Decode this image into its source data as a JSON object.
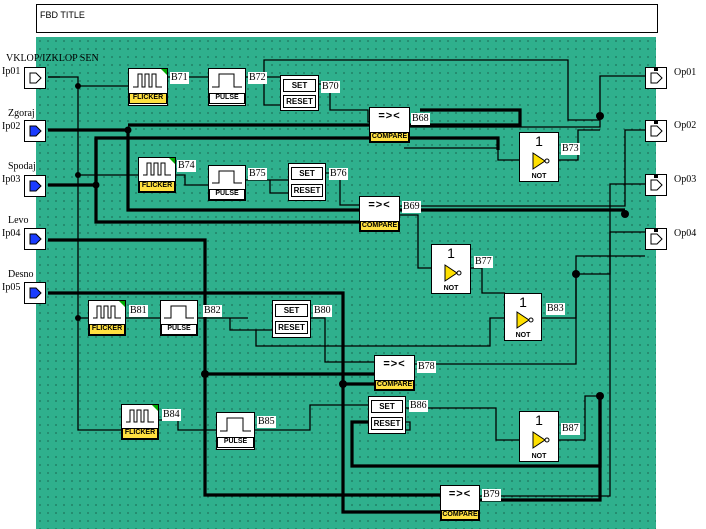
{
  "title": "FBD TITLE",
  "inputs": [
    {
      "id": "Ip01",
      "name": "VKLOP/IZKLOP SEN",
      "color": "#ffffff"
    },
    {
      "id": "Ip02",
      "name": "Zgoraj",
      "color": "#1a3cff"
    },
    {
      "id": "Ip03",
      "name": "Spodaj",
      "color": "#ffffff"
    },
    {
      "id": "Ip04",
      "name": "Levo",
      "color": "#1a3cff"
    },
    {
      "id": "Ip05",
      "name": "Desno",
      "color": "#1a3cff"
    }
  ],
  "outputs": [
    {
      "id": "Op01"
    },
    {
      "id": "Op02"
    },
    {
      "id": "Op03"
    },
    {
      "id": "Op04"
    }
  ],
  "blocks": {
    "b71": {
      "label": "B71",
      "type": "FLICKER",
      "icon": "flicker-icon"
    },
    "b72": {
      "label": "B72",
      "type": "PULSE",
      "icon": "pulse-icon"
    },
    "b70": {
      "label": "B70",
      "type_set": "SET",
      "type_reset": "RESET"
    },
    "b68": {
      "label": "B68",
      "symbol": "=><",
      "type": "COMPARE"
    },
    "b73": {
      "label": "B73",
      "one": "1",
      "type": "NOT",
      "icon": "not-gate-icon"
    },
    "b74": {
      "label": "B74",
      "type": "FLICKER",
      "icon": "flicker-icon"
    },
    "b75": {
      "label": "B75",
      "type": "PULSE",
      "icon": "pulse-icon"
    },
    "b76": {
      "label": "B76",
      "type_set": "SET",
      "type_reset": "RESET"
    },
    "b69": {
      "label": "B69",
      "symbol": "=><",
      "type": "COMPARE"
    },
    "b77": {
      "label": "B77",
      "one": "1",
      "type": "NOT",
      "icon": "not-gate-icon"
    },
    "b81": {
      "label": "B81",
      "type": "FLICKER",
      "icon": "flicker-icon"
    },
    "b82": {
      "label": "B82",
      "type": "PULSE",
      "icon": "pulse-icon"
    },
    "b80": {
      "label": "B80",
      "type_set": "SET",
      "type_reset": "RESET"
    },
    "b83": {
      "label": "B83",
      "one": "1",
      "type": "NOT",
      "icon": "not-gate-icon"
    },
    "b78": {
      "label": "B78",
      "symbol": "=><",
      "type": "COMPARE"
    },
    "b84": {
      "label": "B84",
      "type": "FLICKER",
      "icon": "flicker-icon"
    },
    "b85": {
      "label": "B85",
      "type": "PULSE",
      "icon": "pulse-icon"
    },
    "b86": {
      "label": "B86",
      "type_set": "SET",
      "type_reset": "RESET"
    },
    "b87": {
      "label": "B87",
      "one": "1",
      "type": "NOT",
      "icon": "not-gate-icon"
    },
    "b79": {
      "label": "B79",
      "symbol": "=><",
      "type": "COMPARE"
    }
  },
  "colors": {
    "canvas": "#2fb08d",
    "tag": "#ffe040",
    "not_fill": "#ffe000",
    "blue_input": "#1a3cff"
  }
}
